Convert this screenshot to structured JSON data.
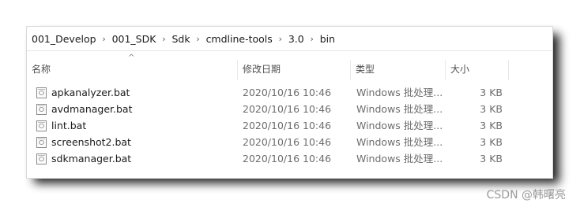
{
  "breadcrumb": [
    "001_Develop",
    "001_SDK",
    "Sdk",
    "cmdline-tools",
    "3.0",
    "bin"
  ],
  "separator": "›",
  "columns": {
    "name": "名称",
    "date": "修改日期",
    "type": "类型",
    "size": "大小",
    "sort_indicator": "^"
  },
  "files": [
    {
      "name": "apkanalyzer.bat",
      "date": "2020/10/16 10:46",
      "type": "Windows 批处理...",
      "size": "3 KB"
    },
    {
      "name": "avdmanager.bat",
      "date": "2020/10/16 10:46",
      "type": "Windows 批处理...",
      "size": "3 KB"
    },
    {
      "name": "lint.bat",
      "date": "2020/10/16 10:46",
      "type": "Windows 批处理...",
      "size": "3 KB"
    },
    {
      "name": "screenshot2.bat",
      "date": "2020/10/16 10:46",
      "type": "Windows 批处理...",
      "size": "3 KB"
    },
    {
      "name": "sdkmanager.bat",
      "date": "2020/10/16 10:46",
      "type": "Windows 批处理...",
      "size": "3 KB"
    }
  ],
  "file_icon": "batch-file-icon",
  "watermark": "CSDN @韩曙亮"
}
